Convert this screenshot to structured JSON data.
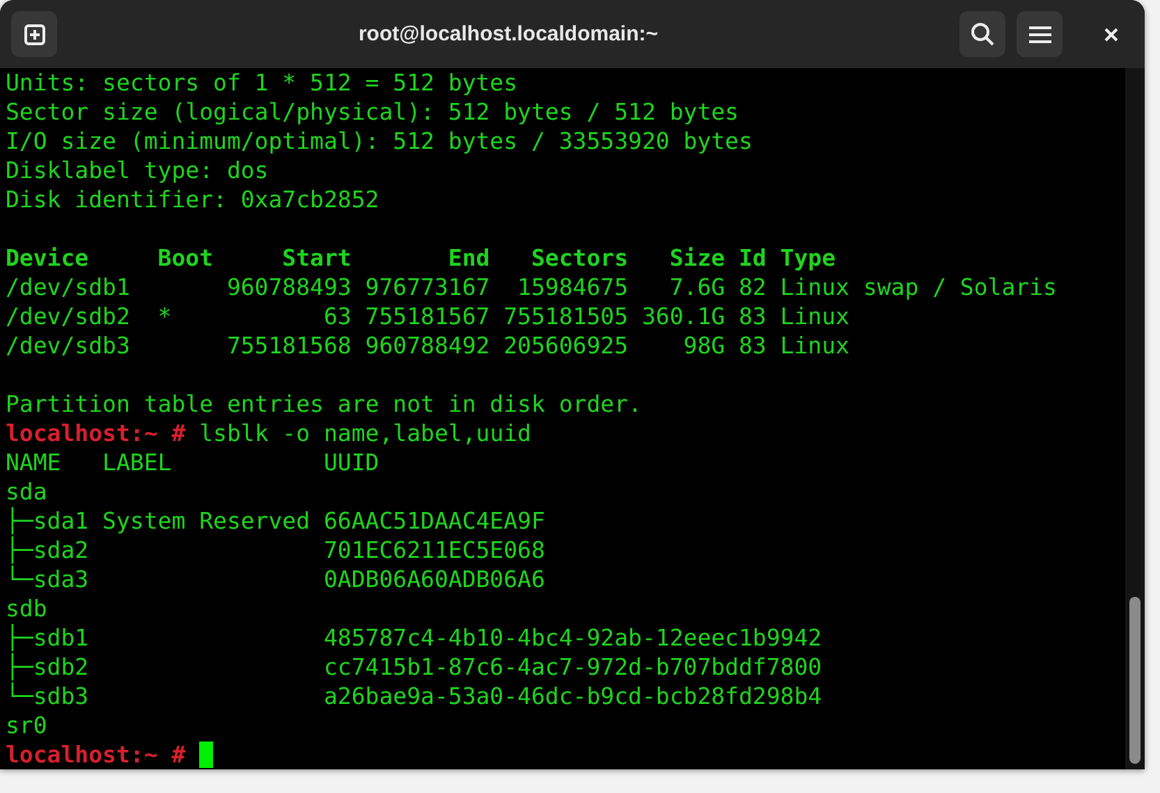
{
  "window": {
    "title": "root@localhost.localdomain:~"
  },
  "terminal": {
    "lines": [
      {
        "kind": "output",
        "text": "Units: sectors of 1 * 512 = 512 bytes"
      },
      {
        "kind": "output",
        "text": "Sector size (logical/physical): 512 bytes / 512 bytes"
      },
      {
        "kind": "output",
        "text": "I/O size (minimum/optimal): 512 bytes / 33553920 bytes"
      },
      {
        "kind": "output",
        "text": "Disklabel type: dos"
      },
      {
        "kind": "output",
        "text": "Disk identifier: 0xa7cb2852"
      },
      {
        "kind": "blank"
      },
      {
        "kind": "header",
        "text": "Device     Boot     Start       End   Sectors   Size Id Type"
      },
      {
        "kind": "output",
        "text": "/dev/sdb1       960788493 976773167  15984675   7.6G 82 Linux swap / Solaris"
      },
      {
        "kind": "output",
        "text": "/dev/sdb2  *           63 755181567 755181505 360.1G 83 Linux"
      },
      {
        "kind": "output",
        "text": "/dev/sdb3       755181568 960788492 205606925    98G 83 Linux"
      },
      {
        "kind": "blank"
      },
      {
        "kind": "output",
        "text": "Partition table entries are not in disk order."
      },
      {
        "kind": "prompt",
        "prompt": "localhost:~ #",
        "command": "lsblk -o name,label,uuid"
      },
      {
        "kind": "output",
        "text": "NAME   LABEL           UUID"
      },
      {
        "kind": "output",
        "text": "sda"
      },
      {
        "kind": "output",
        "text": "├─sda1 System Reserved 66AAC51DAAC4EA9F"
      },
      {
        "kind": "output",
        "text": "├─sda2                 701EC6211EC5E068"
      },
      {
        "kind": "output",
        "text": "└─sda3                 0ADB06A60ADB06A6"
      },
      {
        "kind": "output",
        "text": "sdb"
      },
      {
        "kind": "output",
        "text": "├─sdb1                 485787c4-4b10-4bc4-92ab-12eeec1b9942"
      },
      {
        "kind": "output",
        "text": "├─sdb2                 cc7415b1-87c6-4ac7-972d-b707bddf7800"
      },
      {
        "kind": "output",
        "text": "└─sdb3                 a26bae9a-53a0-46dc-b9cd-bcb28fd298b4"
      },
      {
        "kind": "output",
        "text": "sr0"
      },
      {
        "kind": "prompt",
        "prompt": "localhost:~ #",
        "cursor": true
      }
    ]
  }
}
